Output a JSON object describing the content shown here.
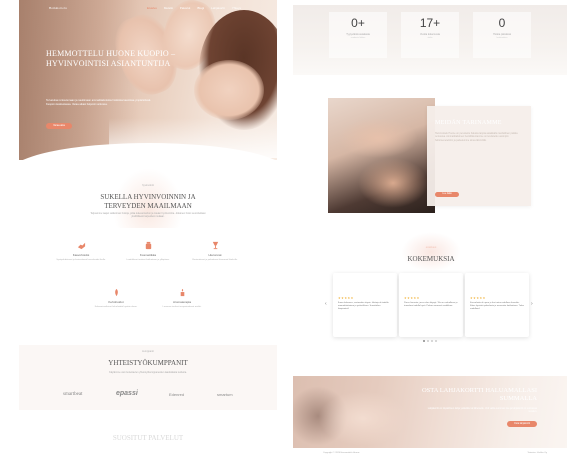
{
  "colors": {
    "accent": "#e8876a",
    "star": "#f0b23a",
    "text_dark": "#555555",
    "muted": "#aaaaaa"
  },
  "left": {
    "nav": {
      "logo": "Hemmottelu",
      "items": [
        "Etusivu",
        "Meistä",
        "Palvelut",
        "Blogi",
        "Lahjakortti",
        "Yhteys"
      ],
      "active_index": 0
    },
    "hero": {
      "title": "HEMMOTTELU HUONE KUOPIO – HYVINVOINTISI ASIANTUNTIJA",
      "text": "Tervetuloa rentoutumaan ja nauttimaan ammattitaitoisista hoidoista kauniissa ympäristössä Kuopion keskustassa. Varaa aikasi helposti verkossa.",
      "button": "Varaa aika"
    },
    "wellness": {
      "label": "hyvinvointi",
      "title": "SUKELLA HYVINVOINNIN JA TERVEYDEN MAAILMAAN",
      "text": "Tarjoamme laajan valikoiman hoitoja, jotka tukevat kehon ja mielen hyvinvointia. Jokainen hoito suunnitellaan yksilöllisesti tarpeidesi mukaan.",
      "features": [
        {
          "icon": "hands-icon",
          "title": "Kasvohoidot",
          "desc": "Syväpuhdistavat ja kosteuttavat kasvohoidot iholle."
        },
        {
          "icon": "bottle-icon",
          "title": "Kosmetiikka",
          "desc": "Laadukkaat tuotteet kotihoitoon ja ylläpitoon."
        },
        {
          "icon": "lamp-icon",
          "title": "Hieronnat",
          "desc": "Rentouttavat ja palauttavat hieronnat lihaksille."
        },
        {
          "icon": "spa-icon",
          "title": "Kehohoidot",
          "desc": "Kokonaisvaltaiset kehohoidot hyvään oloon."
        },
        {
          "icon": "candle-icon",
          "title": "Aromaterapia",
          "desc": "Luonnon tuoksut tasapainottavat mieltä."
        }
      ]
    },
    "partners": {
      "label": "kumppanit",
      "title": "YHTEISTYÖKUMPPANIT",
      "text": "Käytämme vain luotettavien yhteistyökumppaneiden laadukkaita tuotteita.",
      "logos": [
        "smartbeat",
        "epassi",
        "Edenred",
        "smartum"
      ]
    },
    "bottom_title": "SUOSITUT PALVELUT"
  },
  "right": {
    "stats": [
      {
        "num": "0+",
        "label": "Tyytyväistä asiakasta",
        "sub": "vuodesta lähtien"
      },
      {
        "num": "17+",
        "label": "Vuotta kokemusta",
        "sub": "alalta"
      },
      {
        "num": "0",
        "label": "Hoitoa päivässä",
        "sub": "keskimäärin"
      }
    ],
    "about": {
      "title": "MEIDÄN TARINAMME",
      "text": "Hemmottelu Huone on perustettu halusta tarjota asiakkaille rauhallinen paikka rentoutua. Ammattitaitoinen henkilökuntamme on koulutettu uusimpiin hoitomenetelmiin ja palvelemme sinua lämmöllä.",
      "button": "Lue lisää"
    },
    "testimonials": {
      "label": "asiakkaat",
      "title": "KOKEMUKSIA",
      "items": [
        {
          "stars": "★★★★★",
          "text": "Ihana kokemus, rentouduin täysin. Hoitaja oli todella ammattitaitoinen ja ystävällinen. Suosittelen lämpimästi!"
        },
        {
          "stars": "★★★★★",
          "text": "Paras hieronta, jossa olen käynyt. Tila on rauhallinen ja tunnelma todella hyvä. Palaan varmasti uudelleen."
        },
        {
          "stars": "★★★★★",
          "text": "Kasvohoito oli upea ja iho tuntuu edelleen ihanalta. Kiitos hyvästä palvelusta ja neuvoista kotihoitoon. Tulen uudelleen!"
        }
      ],
      "active_dot": 0,
      "dot_count": 4
    },
    "gift": {
      "title": "OSTA LAHJAKORTTI HALUAMALLASI SUMMALLA",
      "text": "Lahjakortti on täydellinen lahja ystävälle tai läheiselle. Voit valita summan itse ja lahjakortti on voimassa vuoden.",
      "button": "Osta lahjakortti"
    },
    "footer": {
      "copyright": "Copyright © 2024 Hemmottelu Huone",
      "credit": "Toteutus: Verkko Oy"
    }
  }
}
